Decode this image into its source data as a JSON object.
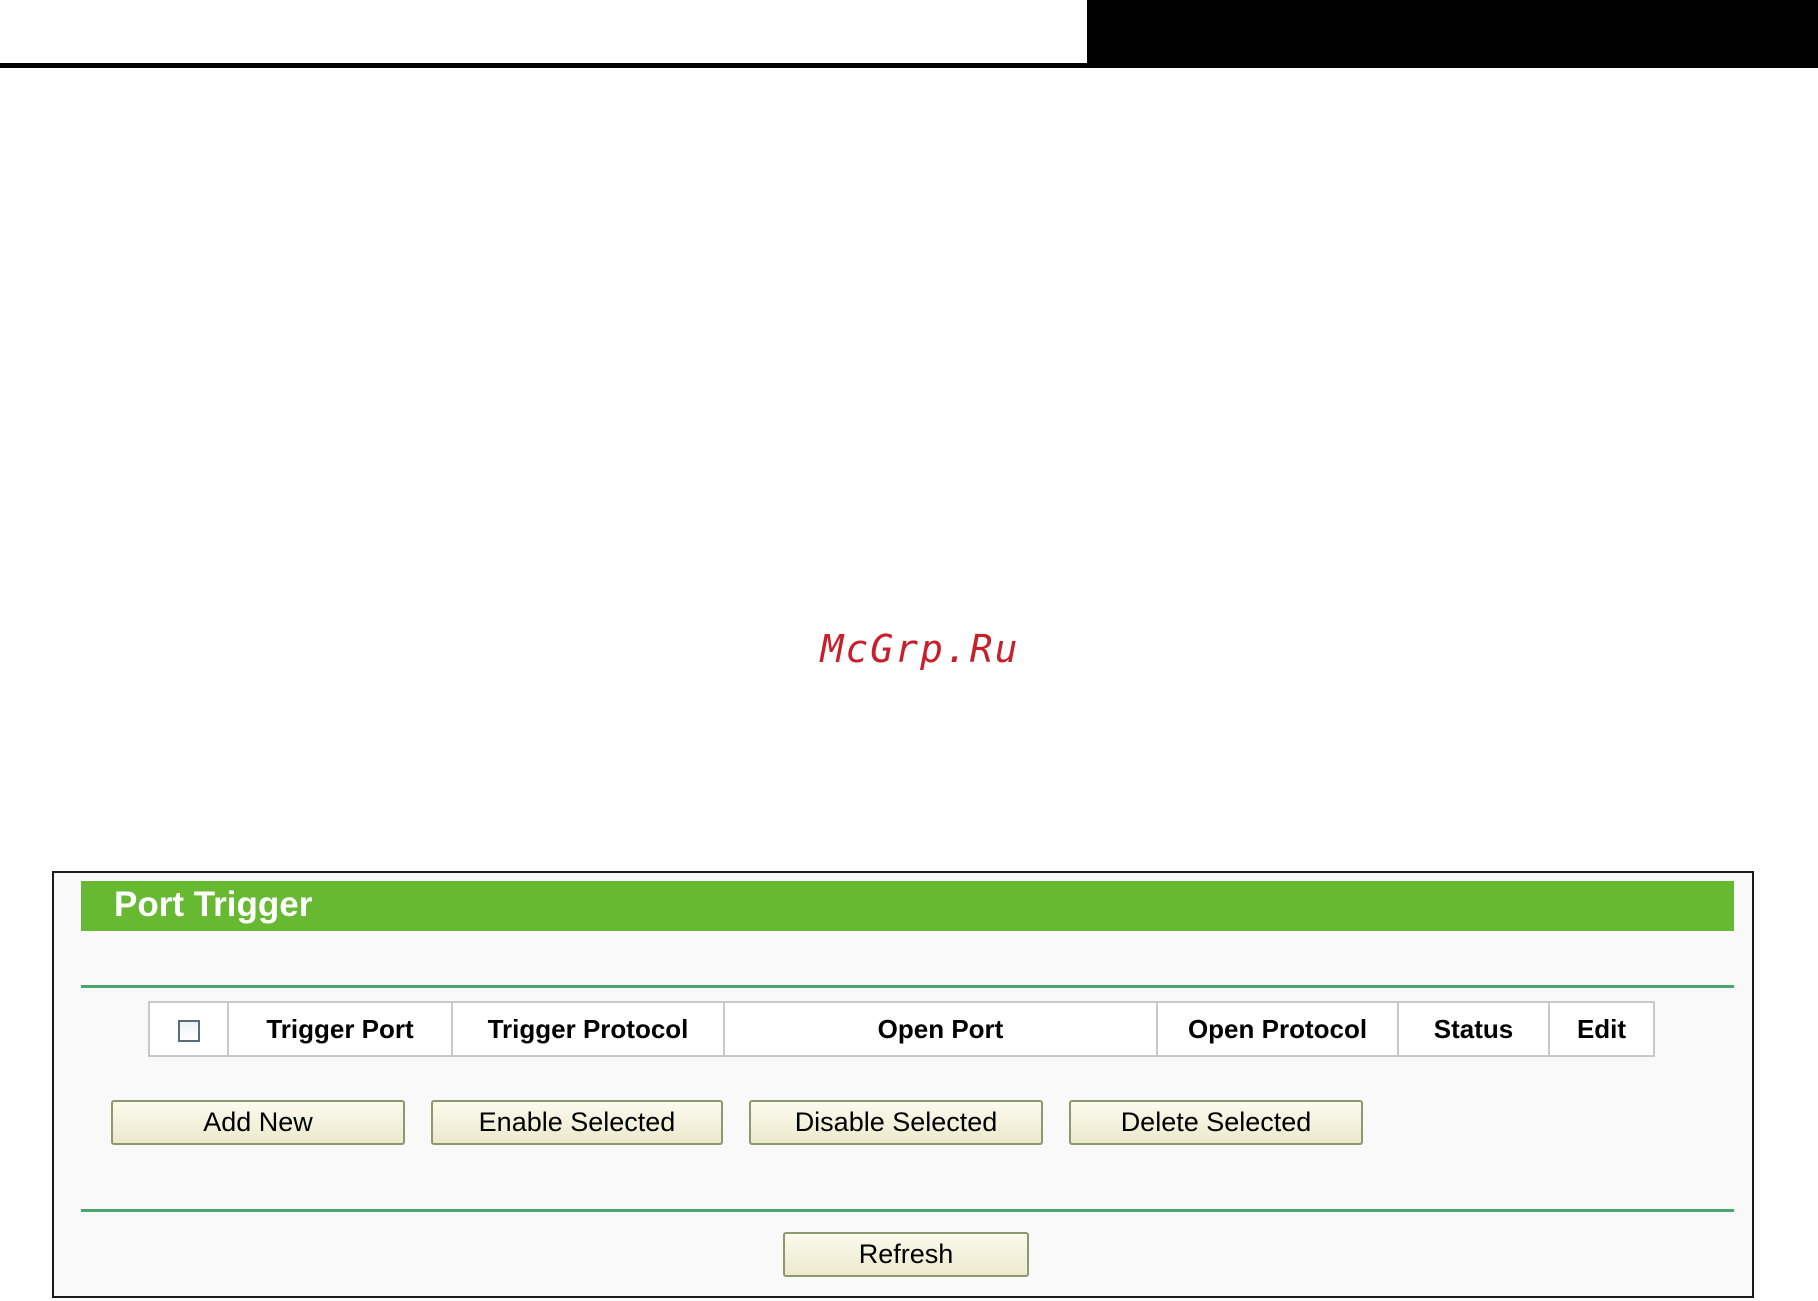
{
  "watermark": "McGrp.Ru",
  "panel": {
    "title": "Port Trigger"
  },
  "table": {
    "columns": [
      "Trigger Port",
      "Trigger Protocol",
      "Open Port",
      "Open Protocol",
      "Status",
      "Edit"
    ]
  },
  "buttons": {
    "add_new": "Add New",
    "enable_selected": "Enable Selected",
    "disable_selected": "Disable Selected",
    "delete_selected": "Delete Selected",
    "refresh": "Refresh"
  },
  "colors": {
    "title_bar": "#67b932",
    "rule": "#4ca56d",
    "watermark": "#c8202a"
  }
}
